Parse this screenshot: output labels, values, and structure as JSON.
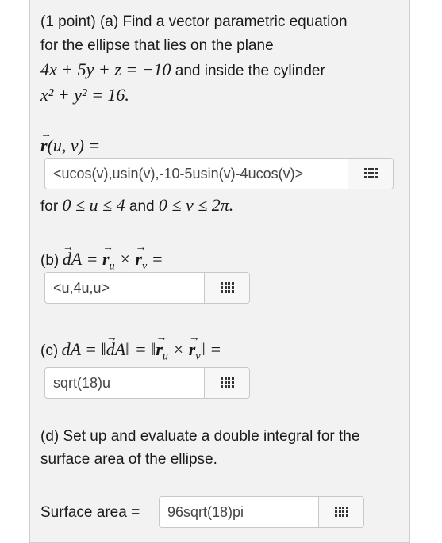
{
  "problem": {
    "intro_a": "(1 point) (a) Find a vector parametric equation",
    "intro_b": "for the ellipse that lies on the plane",
    "plane_eq": "4x + 5y + z = −10",
    "plane_tail": " and inside the cylinder",
    "cyl_eq": "x² + y² = 16.",
    "r_label": "r(u, v) =",
    "range_for": "for ",
    "range_u": "0 ≤ u ≤ 4",
    "range_and": " and ",
    "range_v": "0 ≤ v ≤ 2π."
  },
  "part_b": {
    "label": "(b)",
    "eq": "dA = r_u × r_v ="
  },
  "part_c": {
    "label": "(c)",
    "eq": "dA = ‖dA‖ = ‖r_u × r_v‖ ="
  },
  "part_d": {
    "line1": "(d) Set up and evaluate a double integral for the",
    "line2": "surface area of the ellipse.",
    "sa_label": "Surface area ="
  },
  "answers": {
    "a": "<ucos(v),usin(v),-10-5usin(v)-4ucos(v)>",
    "b": "<u,4u,u>",
    "c": "sqrt(18)u",
    "d": "96sqrt(18)pi"
  },
  "icons": {
    "toolbar": "grid-keypad-icon"
  }
}
